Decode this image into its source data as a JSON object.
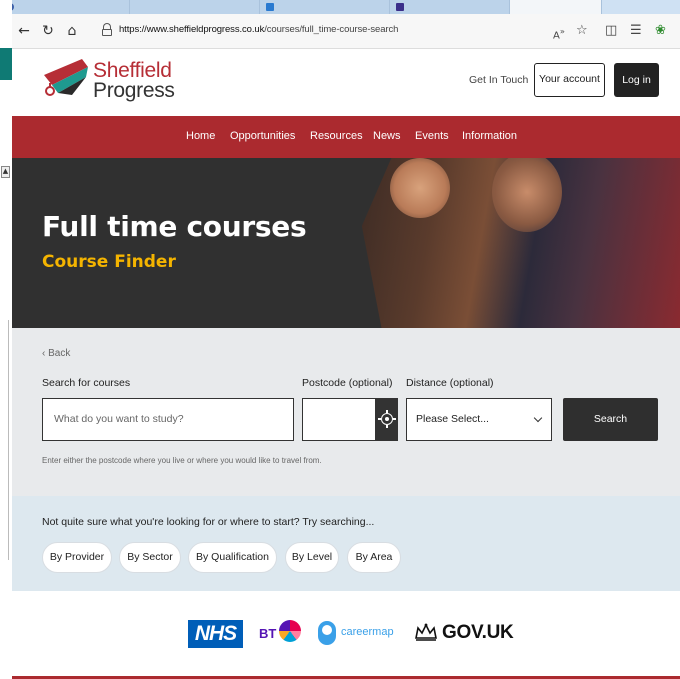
{
  "browser": {
    "url_host": "https://www.sheffieldprogress.co.uk",
    "url_path": "/courses/full_time-course-search",
    "icons": [
      "back-icon",
      "refresh-icon",
      "home-icon",
      "lock-icon",
      "read-aloud-icon",
      "favorite-icon",
      "split-screen-icon",
      "favorites-bar-icon",
      "extensions-icon"
    ]
  },
  "header": {
    "logo_line1": "Sheffield",
    "logo_line2": "Progress",
    "get_in_touch": "Get In Touch",
    "account_label": "Your account",
    "login_label": "Log in"
  },
  "nav": {
    "items": [
      "Home",
      "Opportunities",
      "Resources",
      "News",
      "Events",
      "Information"
    ]
  },
  "hero": {
    "title": "Full time courses",
    "subtitle": "Course Finder"
  },
  "search": {
    "back_label": "‹ Back",
    "search_label": "Search for courses",
    "search_placeholder": "What do you want to study?",
    "postcode_label": "Postcode (optional)",
    "distance_label": "Distance (optional)",
    "distance_value": "Please Select...",
    "search_button": "Search",
    "help_text": "Enter either the postcode where you live or where you would like to travel from."
  },
  "quick": {
    "title": "Not quite sure what you're looking for or where to start? Try searching...",
    "pills": [
      "By Provider",
      "By Sector",
      "By Qualification",
      "By Level",
      "By Area"
    ]
  },
  "partners": {
    "nhs": "NHS",
    "bt": "BT",
    "careermap": "careermap",
    "gov": "GOV.UK"
  },
  "colors": {
    "brand_red": "#ab2a2f",
    "hero_yellow": "#f4b400",
    "dark": "#2f2f2f"
  }
}
